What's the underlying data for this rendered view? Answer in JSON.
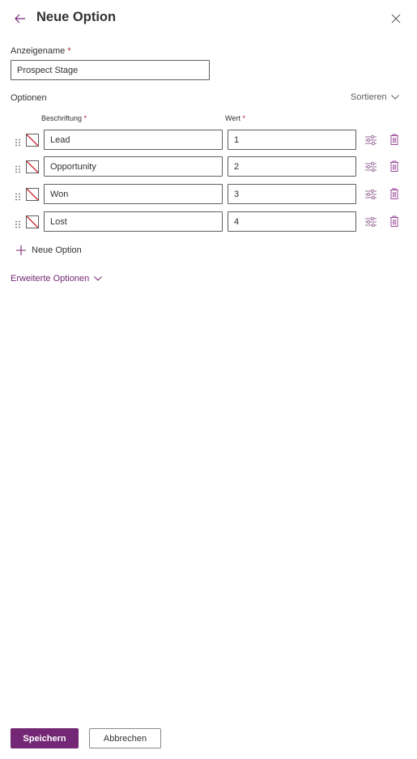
{
  "header": {
    "title": "Neue Option",
    "back_icon": "arrow-left-icon",
    "close_icon": "close-icon"
  },
  "display_name": {
    "label": "Anzeigename",
    "required_marker": "*",
    "value": "Prospect Stage"
  },
  "options": {
    "section_label": "Optionen",
    "sort_label": "Sortieren",
    "column_label": "Beschriftung",
    "column_value": "Wert",
    "required_marker": "*",
    "rows": [
      {
        "label": "Lead",
        "value": "1"
      },
      {
        "label": "Opportunity",
        "value": "2"
      },
      {
        "label": "Won",
        "value": "3"
      },
      {
        "label": "Lost",
        "value": "4"
      }
    ],
    "add_option_label": "Neue Option"
  },
  "advanced": {
    "label": "Erweiterte Optionen"
  },
  "footer": {
    "save_label": "Speichern",
    "cancel_label": "Abbrechen"
  },
  "colors": {
    "accent": "#742774",
    "required": "#a4262c",
    "swatch_slash": "#c50f1f"
  }
}
